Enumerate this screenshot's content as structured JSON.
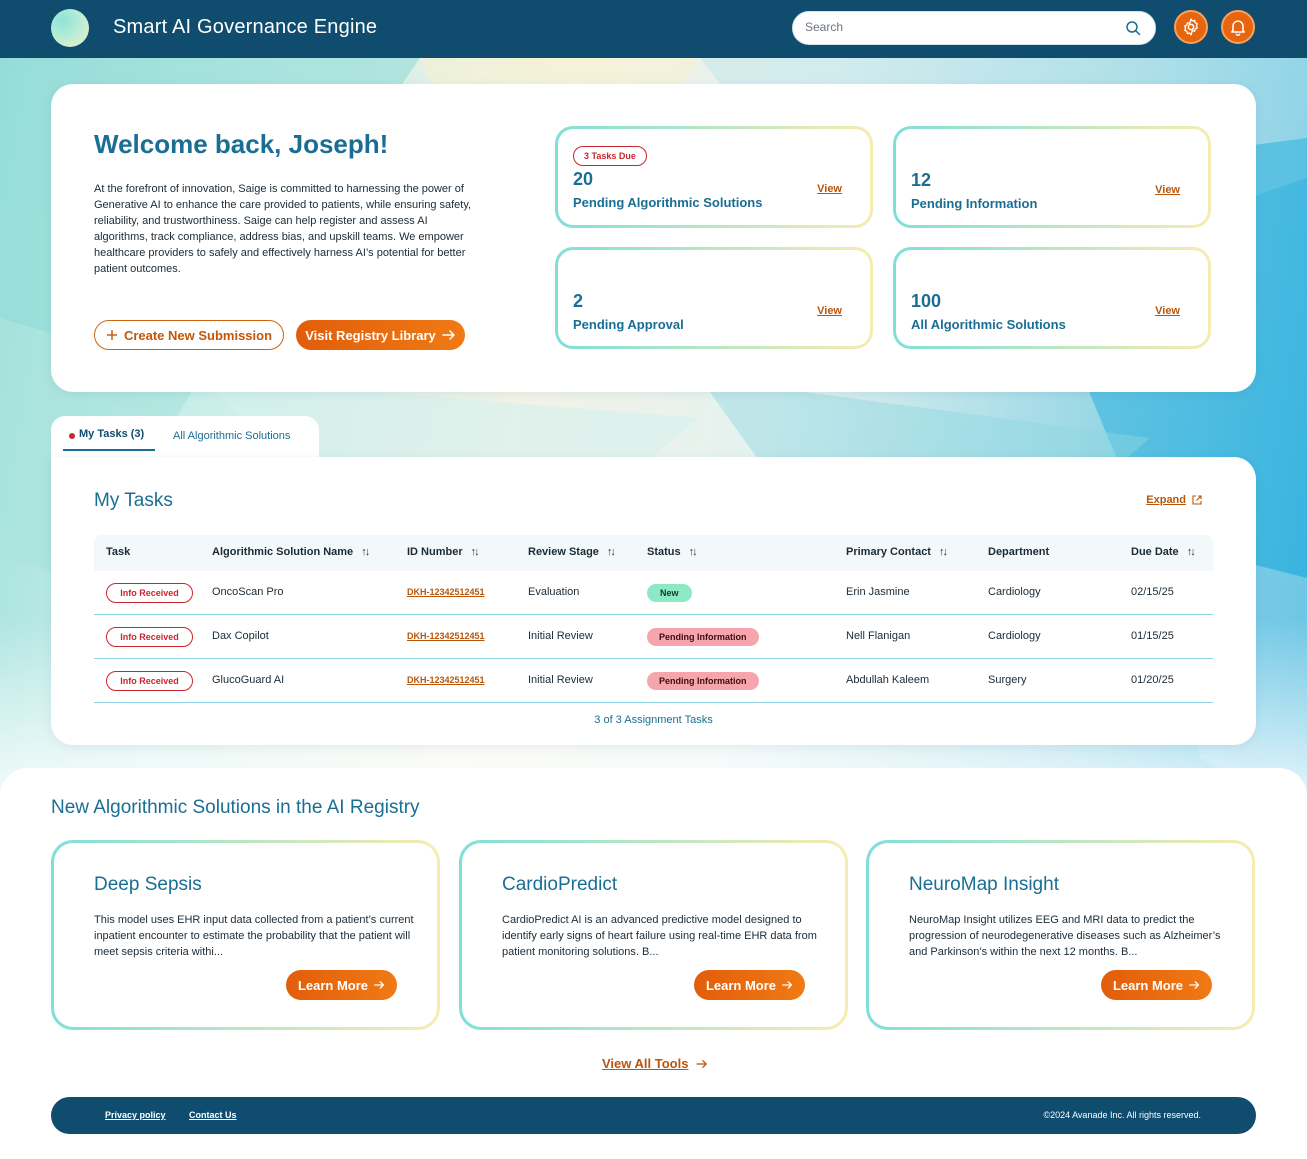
{
  "header": {
    "title": "Smart AI Governance Engine",
    "search_placeholder": "Search"
  },
  "welcome": {
    "heading": "Welcome back, Joseph!",
    "body": "At the forefront of innovation, Saige is committed to harnessing the power of Generative AI to enhance the care provided to patients, while ensuring safety, reliability, and trustworthiness.  Saige can help register and assess AI algorithms, track compliance, address bias, and upskill teams.  We empower healthcare providers to safely and effectively harness AI’s potential for better patient outcomes.",
    "create_label": "Create New Submission",
    "visit_label": "Visit Registry Library"
  },
  "stats": [
    {
      "badge": "3 Tasks Due",
      "value": "20",
      "label": "Pending Algorithmic Solutions",
      "link": "View"
    },
    {
      "value": "12",
      "label": "Pending Information",
      "link": "View"
    },
    {
      "value": "2",
      "label": "Pending Approval",
      "link": "View"
    },
    {
      "value": "100",
      "label": "All Algorithmic Solutions",
      "link": "View"
    }
  ],
  "tabs": {
    "my_tasks": "My Tasks (3)",
    "all_solutions": "All Algorithmic Solutions"
  },
  "tasks": {
    "title": "My Tasks",
    "expand_label": "Expand",
    "columns": [
      "Task",
      "Algorithmic Solution Name",
      "ID Number",
      "Review Stage",
      "Status",
      "Primary Contact",
      "Department",
      "Due Date"
    ],
    "rows": [
      {
        "task": "Info Received",
        "name": "OncoScan Pro",
        "id": "DKH-12342512451",
        "stage": "Evaluation",
        "status": "New",
        "contact": "Erin Jasmine",
        "dept": "Cardiology",
        "due": "02/15/25"
      },
      {
        "task": "Info Received",
        "name": "Dax Copilot",
        "id": "DKH-12342512451",
        "stage": "Initial Review",
        "status": "Pending Information",
        "contact": "Nell Flanigan",
        "dept": "Cardiology",
        "due": "01/15/25"
      },
      {
        "task": "Info Received",
        "name": "GlucoGuard AI",
        "id": "DKH-12342512451",
        "stage": "Initial Review",
        "status": "Pending Information",
        "contact": "Abdullah Kaleem",
        "dept": "Surgery",
        "due": "01/20/25"
      }
    ],
    "footer": "3 of 3 Assignment Tasks"
  },
  "registry": {
    "title": "New Algorithmic Solutions in the AI Registry",
    "cards": [
      {
        "name": "Deep Sepsis",
        "desc": "This model uses EHR input data collected from a patient’s current inpatient encounter to estimate the probability that the patient will meet sepsis criteria withi...",
        "cta": "Learn More"
      },
      {
        "name": "CardioPredict",
        "desc": "CardioPredict AI is an advanced predictive model designed to identify early signs of heart failure using real-time EHR data from patient monitoring solutions. B...",
        "cta": "Learn More"
      },
      {
        "name": "NeuroMap Insight",
        "desc": "NeuroMap Insight utilizes EEG and MRI data to predict the progression of neurodegenerative diseases such as Alzheimer’s and Parkinson’s within the next 12 months. B...",
        "cta": "Learn More"
      }
    ],
    "view_all": "View All Tools"
  },
  "footer": {
    "privacy": "Privacy policy",
    "contact": "Contact Us",
    "copyright": "©2024 Avanade Inc. All rights reserved."
  }
}
